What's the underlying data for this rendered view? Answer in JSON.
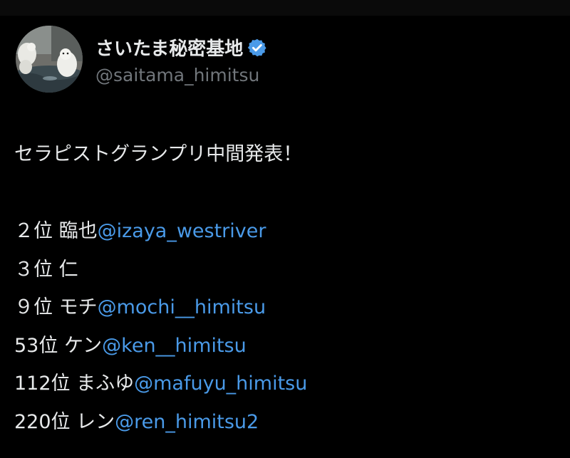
{
  "theme": {
    "background": "#000000",
    "text": "#e7e9ea",
    "muted": "#71767b",
    "link": "#4a9ae8",
    "verified_badge": "#4a9ae8"
  },
  "profile": {
    "display_name": "さいたま秘密基地",
    "handle": "@saitama_himitsu",
    "verified": true,
    "avatar_icon": "avatar-photo-icon"
  },
  "post": {
    "headline": "セラピストグランプリ中間発表！",
    "rankings": [
      {
        "rank": "２位 ",
        "name": "臨也",
        "mention": "@izaya_westriver"
      },
      {
        "rank": "３位 ",
        "name": "仁",
        "mention": ""
      },
      {
        "rank": "９位 ",
        "name": "モチ",
        "mention": "@mochi__himitsu"
      },
      {
        "rank": "53位 ",
        "name": "ケン",
        "mention": "@ken__himitsu"
      },
      {
        "rank": "112位 ",
        "name": "まふゆ",
        "mention": "@mafuyu_himitsu"
      },
      {
        "rank": "220位 ",
        "name": "レン",
        "mention": "@ren_himitsu2"
      }
    ]
  }
}
